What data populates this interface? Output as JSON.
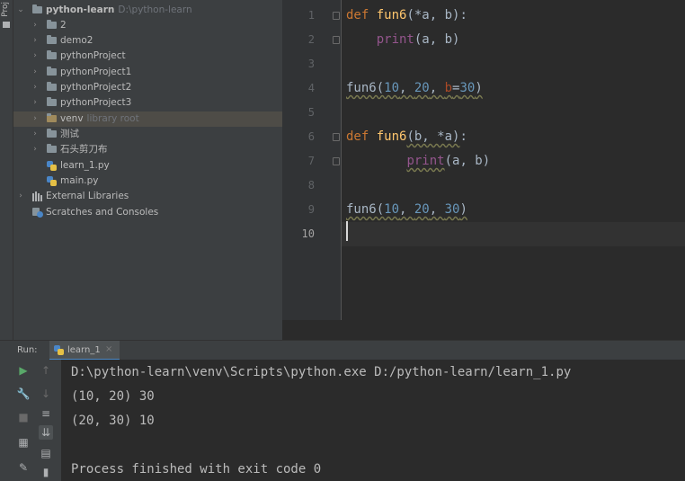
{
  "left_stripe": {
    "label": "Proj"
  },
  "project_tree": {
    "root": {
      "name": "python-learn",
      "path": "D:\\python-learn"
    },
    "items": [
      {
        "label": "2"
      },
      {
        "label": "demo2"
      },
      {
        "label": "pythonProject"
      },
      {
        "label": "pythonProject1"
      },
      {
        "label": "pythonProject2"
      },
      {
        "label": "pythonProject3"
      },
      {
        "label": "venv",
        "hint": "library root"
      },
      {
        "label": "测试"
      },
      {
        "label": "石头剪刀布"
      },
      {
        "label": "learn_1.py"
      },
      {
        "label": "main.py"
      }
    ],
    "external_libraries": "External Libraries",
    "scratches": "Scratches and Consoles"
  },
  "editor": {
    "line_numbers": [
      "1",
      "2",
      "3",
      "4",
      "5",
      "6",
      "7",
      "8",
      "9",
      "10"
    ],
    "current_line": 10
  },
  "run_panel": {
    "label": "Run:",
    "tab_name": "learn_1",
    "tab_close": "×",
    "output": [
      "D:\\python-learn\\venv\\Scripts\\python.exe D:/python-learn/learn_1.py",
      "(10, 20) 30",
      "(20, 30) 10",
      "",
      "Process finished with exit code 0"
    ]
  },
  "colors": {
    "keyword": "#cc7832",
    "function": "#ffc66d",
    "number": "#6897bb",
    "named_param": "#aa4926",
    "text": "#a9b7c6",
    "background": "#2b2b2b",
    "panel": "#3c3f41"
  }
}
